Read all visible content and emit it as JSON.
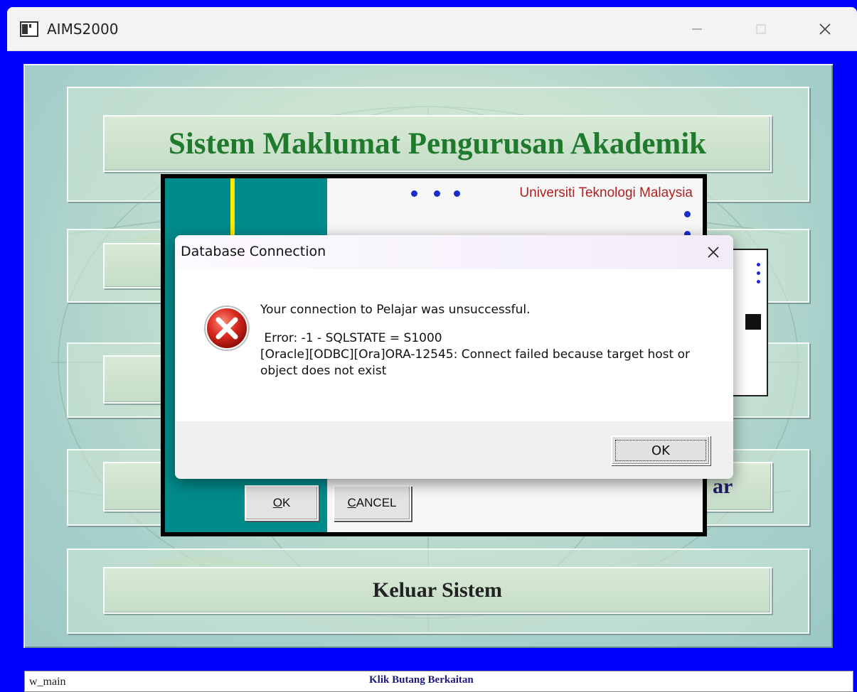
{
  "window": {
    "title": "AIMS2000",
    "controls": [
      "minimize-icon",
      "maximize-icon",
      "close-icon"
    ]
  },
  "menu": {
    "title_button": "Sistem Maklumat Pengurusan Akademik",
    "exit_button": "Keluar Sistem",
    "partial_right_text": "ar"
  },
  "splash": {
    "university": "Universiti Teknologi Malaysia",
    "ok_label_u": "O",
    "ok_label_rest": "K",
    "cancel_label_u": "C",
    "cancel_label_rest": "ANCEL"
  },
  "dialog": {
    "title": "Database Connection",
    "message_line1": "Your connection to Pelajar was unsuccessful.",
    "message_line2": " Error: -1 - SQLSTATE = S1000",
    "message_line3": "[Oracle][ODBC][Ora]ORA-12545: Connect failed because target host or object does not exist",
    "ok_label": "OK",
    "icon": "error-icon"
  },
  "statusbar": {
    "left": "w_main",
    "center": "Klik Butang Berkaitan"
  },
  "colors": {
    "client_bg": "#0000ff",
    "title_green": "#1f7a2e",
    "splash_teal": "#008b8b",
    "error_red": "#c81e1e"
  }
}
